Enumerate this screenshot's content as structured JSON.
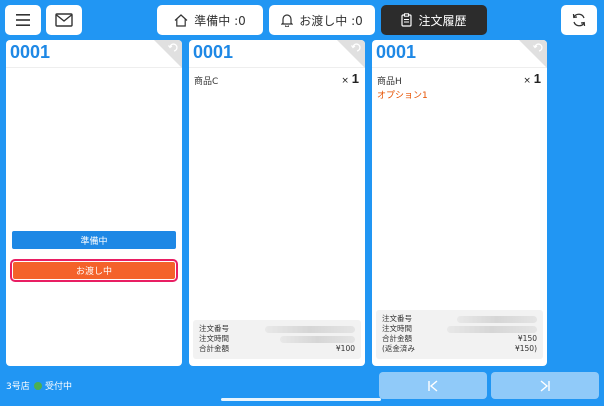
{
  "header": {
    "tabs": [
      {
        "label": "準備中 :0",
        "icon": "home-icon"
      },
      {
        "label": "お渡し中 :0",
        "icon": "bell-icon"
      },
      {
        "label": "注文履歴",
        "icon": "clipboard-icon"
      }
    ],
    "active_tab": 2,
    "icons": [
      "menu-icon",
      "mail-icon",
      "refresh-icon"
    ]
  },
  "cards": [
    {
      "order_no": "0001",
      "buttons": {
        "preparing": "準備中",
        "handoff": "お渡し中"
      }
    },
    {
      "order_no": "0001",
      "item": {
        "name": "商品C",
        "qty_prefix": "×",
        "qty": "1"
      },
      "info": {
        "order_number_label": "注文番号",
        "order_time_label": "注文時間",
        "total_label": "合計金額",
        "total_value": "¥100"
      }
    },
    {
      "order_no": "0001",
      "item": {
        "name": "商品H",
        "qty_prefix": "×",
        "qty": "1",
        "option": "オプション1"
      },
      "info": {
        "order_number_label": "注文番号",
        "order_time_label": "注文時間",
        "total_label": "合計金額",
        "total_value": "¥150",
        "refund_label": "(返金済み",
        "refund_value": "¥150)"
      }
    }
  ],
  "footer": {
    "store": "3号店",
    "status": "受付中",
    "status_color": "#4caf50"
  },
  "colors": {
    "background": "#2196f3",
    "accent": "#1e88e5",
    "handoff": "#f4622a",
    "option": "#e65100"
  }
}
